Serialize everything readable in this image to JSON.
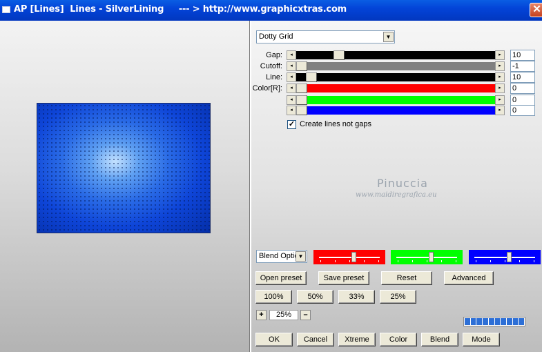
{
  "window": {
    "title": "AP [Lines]  Lines - SilverLining     --- > http://www.graphicxtras.com",
    "close_label": "✕"
  },
  "preset_dropdown": {
    "value": "Dotty Grid"
  },
  "sliders": [
    {
      "label": "Gap:",
      "value": "10",
      "fill": "#000000",
      "position": 0.2
    },
    {
      "label": "Cutoff:",
      "value": "-1",
      "fill": "#808080",
      "position": 0.0
    },
    {
      "label": "Line:",
      "value": "10",
      "fill": "#000000",
      "position": 0.05
    },
    {
      "label": "Color[R]:",
      "value": "0",
      "fill": "#ff0000",
      "position": 0.0
    },
    {
      "label": "",
      "value": "0",
      "fill": "#00ff00",
      "position": 0.0
    },
    {
      "label": "",
      "value": "0",
      "fill": "#0000ff",
      "position": 0.0
    }
  ],
  "checkbox": {
    "label": "Create lines not gaps",
    "checked": true,
    "mark": "✓"
  },
  "watermark": {
    "name": "Pinuccia",
    "site": "www.maidiregrafica.eu"
  },
  "blend": {
    "dropdown": "Blend Optio",
    "mini_sliders": [
      {
        "color": "#ff0000",
        "position": 0.58
      },
      {
        "color": "#00ff00",
        "position": 0.58
      },
      {
        "color": "#0000ff",
        "position": 0.58
      }
    ]
  },
  "buttons_row1": [
    "Open preset",
    "Save preset",
    "Reset",
    "Advanced"
  ],
  "buttons_zoom": [
    "100%",
    "50%",
    "33%",
    "25%"
  ],
  "zoom": {
    "plus": "+",
    "value": "25%",
    "minus": "–"
  },
  "progress_segments": 10,
  "buttons_bottom": [
    "OK",
    "Cancel",
    "Xtreme",
    "Color",
    "Blend",
    "Mode"
  ]
}
